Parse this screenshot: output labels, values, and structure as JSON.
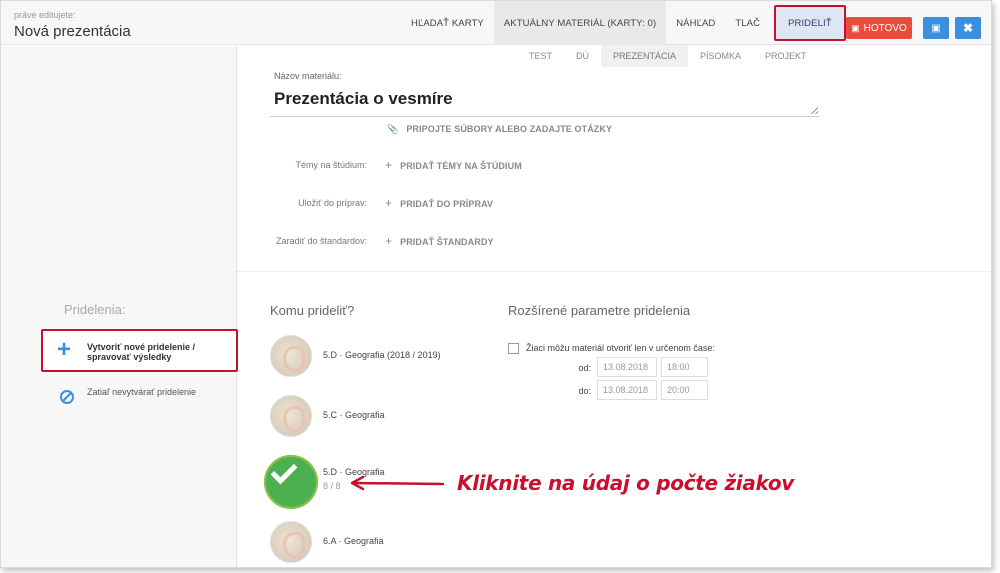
{
  "header": {
    "editing_label": "práve editujete:",
    "title": "Nová prezentácia",
    "nav": {
      "search_cards": "HĽADAŤ KARTY",
      "current_material": "AKTUÁLNY MATERIÁL (KARTY: 0)",
      "preview": "NÁHĽAD",
      "print": "TLAČ",
      "assign": "PRIDELIŤ"
    },
    "done_label": "HOTOVO",
    "save_icon": "floppy-icon",
    "close_icon": "close-icon"
  },
  "type_tabs": [
    "TEST",
    "DÚ",
    "PREZENTÁCIA",
    "PÍSOMKA",
    "PROJEKT"
  ],
  "active_type_tab": "PREZENTÁCIA",
  "material": {
    "name_label": "Názov materiálu:",
    "name_value": "Prezentácia o vesmíre",
    "attach_label": "PRIPOJTE SÚBORY ALEBO ZADAJTE OTÁZKY"
  },
  "rows": [
    {
      "label": "Témy na štúdium:",
      "action": "PRIDAŤ TÉMY NA ŠTÚDIUM"
    },
    {
      "label": "Uložiť do príprav:",
      "action": "PRIDAŤ DO PRÍPRAV"
    },
    {
      "label": "Zaradiť do štandardov:",
      "action": "PRIDAŤ ŠTANDARDY"
    }
  ],
  "sidebar": {
    "heading": "Pridelenia:",
    "new_assignment": "Vytvoriť nové pridelenie / spravovať výsledky",
    "no_assignment": "Zatiaľ nevytvárať pridelenie"
  },
  "assign": {
    "who_heading": "Komu prideliť?",
    "classes": [
      {
        "code": "5.D",
        "name": "Geografia (2018 / 2019)",
        "selected": false
      },
      {
        "code": "5.C",
        "name": "Geografia",
        "selected": false
      },
      {
        "code": "5.D",
        "name": "Geografia",
        "selected": true,
        "count": "8 / 8"
      },
      {
        "code": "6.A",
        "name": "Geografia",
        "selected": false
      }
    ]
  },
  "extended": {
    "heading": "Rozšírené parametre pridelenia",
    "checkbox_label": "Žiaci môžu materiál otvoriť len v určenom čase:",
    "from_label": "od:",
    "to_label": "do:",
    "from_date": "13.08.2018",
    "from_time": "18:00",
    "to_date": "13.08.2018",
    "to_time": "20:00"
  },
  "annotation": "Kliknite na údaj o počte žiakov",
  "colors": {
    "accent": "#3b8fe0",
    "danger": "#e74c3c",
    "highlight": "#c8102e",
    "success": "#4caf50"
  }
}
